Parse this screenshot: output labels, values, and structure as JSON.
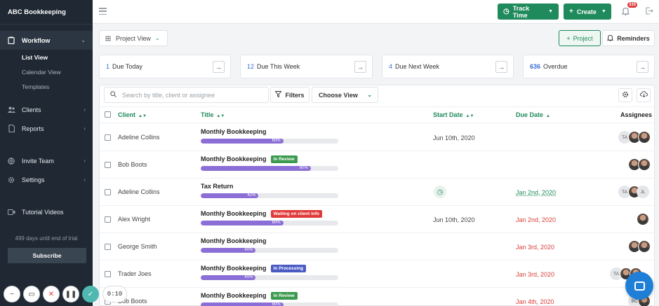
{
  "brand": "ABC Bookkeeping",
  "sidebar": {
    "workflow": "Workflow",
    "sub": [
      "List View",
      "Calendar View",
      "Templates"
    ],
    "clients": "Clients",
    "reports": "Reports",
    "invite": "Invite Team",
    "settings": "Settings",
    "tutorial": "Tutorial Videos",
    "trial": "499 days until end of trial",
    "subscribe": "Subscribe"
  },
  "topbar": {
    "track_time": "Track Time",
    "create": "Create",
    "notif_count": "335"
  },
  "toolbar": {
    "project_view": "Project View",
    "project": "Project",
    "reminders": "Reminders"
  },
  "due": [
    {
      "num": "1",
      "label": "Due Today"
    },
    {
      "num": "12",
      "label": "Due This Week"
    },
    {
      "num": "4",
      "label": "Due Next Week"
    },
    {
      "num": "636",
      "label": "Overdue"
    }
  ],
  "filters": {
    "search_placeholder": "Search by title, client or assignee",
    "filters": "Filters",
    "choose_view": "Choose View"
  },
  "columns": {
    "client": "Client",
    "title": "Title",
    "start": "Start Date",
    "due": "Due Date",
    "assignees": "Assignees"
  },
  "colors": {
    "green": "#1f8a5b",
    "progress": "#8b6fd6",
    "in_review": "#3b9a4f",
    "waiting": "#e03a3a",
    "in_processing": "#4a5bc4",
    "overdue": "#d9413b"
  },
  "rows": [
    {
      "client": "Adeline Collins",
      "title": "Monthly Bookkeeping",
      "tag": "",
      "progress": "60%",
      "start": "Jun 10th, 2020",
      "due": "",
      "assignee_initials": "TA"
    },
    {
      "client": "Bob Boots",
      "title": "Monthly Bookkeeping",
      "tag": "In Review",
      "progress": "80%",
      "start": "",
      "due": "",
      "assignee_initials": ""
    },
    {
      "client": "Adeline Collins",
      "title": "Tax Return",
      "tag": "",
      "progress": "42%",
      "start": "",
      "due": "Jan 2nd, 2020",
      "assignee_initials": "TA",
      "assignee_initials_2": "JL"
    },
    {
      "client": "Alex Wright",
      "title": "Monthly Bookkeeping",
      "tag": "Waiting on client info",
      "progress": "60%",
      "start": "Jun 10th, 2020",
      "due": "Jan 2nd, 2020",
      "assignee_initials": ""
    },
    {
      "client": "George Smith",
      "title": "Monthly Bookkeeping",
      "tag": "",
      "progress": "40%",
      "start": "",
      "due": "Jan 3rd, 2020",
      "assignee_initials": ""
    },
    {
      "client": "Trader Joes",
      "title": "Monthly Bookkeeping",
      "tag": "In Processing",
      "progress": "40%",
      "start": "",
      "due": "Jan 3rd, 2020",
      "assignee_initials": "TA"
    },
    {
      "client": "Bob Boots",
      "title": "Monthly Bookkeeping",
      "tag": "In Review",
      "progress": "60%",
      "start": "",
      "due": "Jan 4th, 2020",
      "assignee_initials": "BC"
    }
  ],
  "recorder": {
    "timer": "0:10"
  }
}
